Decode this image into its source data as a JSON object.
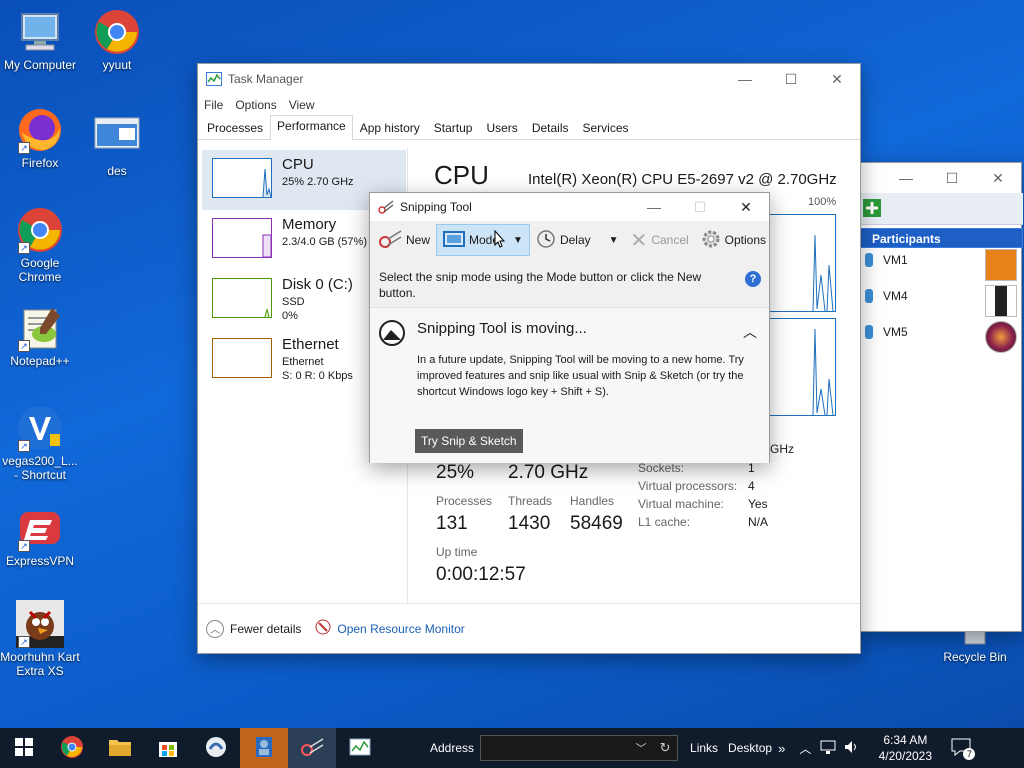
{
  "desktop": {
    "icons": [
      {
        "label": "My Computer"
      },
      {
        "label": "yyuut"
      },
      {
        "label": "Firefox"
      },
      {
        "label": "des"
      },
      {
        "label": "Google Chrome"
      },
      {
        "label": "Notepad++"
      },
      {
        "label": "vegas200_L... - Shortcut"
      },
      {
        "label": "ExpressVPN"
      },
      {
        "label": "Moorhuhn Kart Extra XS"
      },
      {
        "label": "Recycle Bin"
      }
    ]
  },
  "task_manager": {
    "title": "Task Manager",
    "menu": [
      "File",
      "Options",
      "View"
    ],
    "tabs": [
      "Processes",
      "Performance",
      "App history",
      "Startup",
      "Users",
      "Details",
      "Services"
    ],
    "active_tab": "Performance",
    "resources": [
      {
        "name": "CPU",
        "line2": "25% 2.70 GHz",
        "line3": "",
        "color": "#1e6fbd"
      },
      {
        "name": "Memory",
        "line2": "2.3/4.0 GB (57%)",
        "line3": "",
        "color": "#8b2fb3"
      },
      {
        "name": "Disk 0 (C:)",
        "line2": "SSD",
        "line3": "0%",
        "color": "#4e9a06"
      },
      {
        "name": "Ethernet",
        "line2": "Ethernet",
        "line3": "S: 0 R: 0 Kbps",
        "color": "#a65f00"
      }
    ],
    "cpu_heading": "CPU",
    "cpu_model": "Intel(R) Xeon(R) CPU E5-2697 v2 @ 2.70GHz",
    "graph_max": "100%",
    "utilization": "25%",
    "speed": "2.70 GHz",
    "speed_right": "GHz",
    "processes_label": "Processes",
    "processes": "131",
    "threads_label": "Threads",
    "threads": "1430",
    "handles_label": "Handles",
    "handles": "58469",
    "uptime_label": "Up time",
    "uptime": "0:00:12:57",
    "specs": [
      {
        "label": "Sockets:",
        "value": "1"
      },
      {
        "label": "Virtual processors:",
        "value": "4"
      },
      {
        "label": "Virtual machine:",
        "value": "Yes"
      },
      {
        "label": "L1 cache:",
        "value": "N/A"
      }
    ],
    "fewer_details": "Fewer details",
    "resource_monitor": "Open Resource Monitor"
  },
  "participants": {
    "header": "Participants",
    "items": [
      {
        "label": "VM1",
        "avatar_color": "#e8831a"
      },
      {
        "label": "VM4",
        "avatar_color": "#222222"
      },
      {
        "label": "VM5",
        "avatar_color": "#8a1f4a"
      }
    ]
  },
  "snipping_tool": {
    "title": "Snipping Tool",
    "new": "New",
    "mode": "Mode",
    "delay": "Delay",
    "cancel": "Cancel",
    "options": "Options",
    "hint": "Select the snip mode using the Mode button or click the New button.",
    "notice_title": "Snipping Tool is moving...",
    "notice_body": "In a future update, Snipping Tool will be moving to a new home. Try improved features and snip like usual with Snip & Sketch (or try the shortcut Windows logo key + Shift + S).",
    "notice_button": "Try Snip & Sketch"
  },
  "taskbar": {
    "address_label": "Address",
    "links": "Links",
    "desktop": "Desktop",
    "time": "6:34 AM",
    "date": "4/20/2023",
    "notifications": "7"
  }
}
